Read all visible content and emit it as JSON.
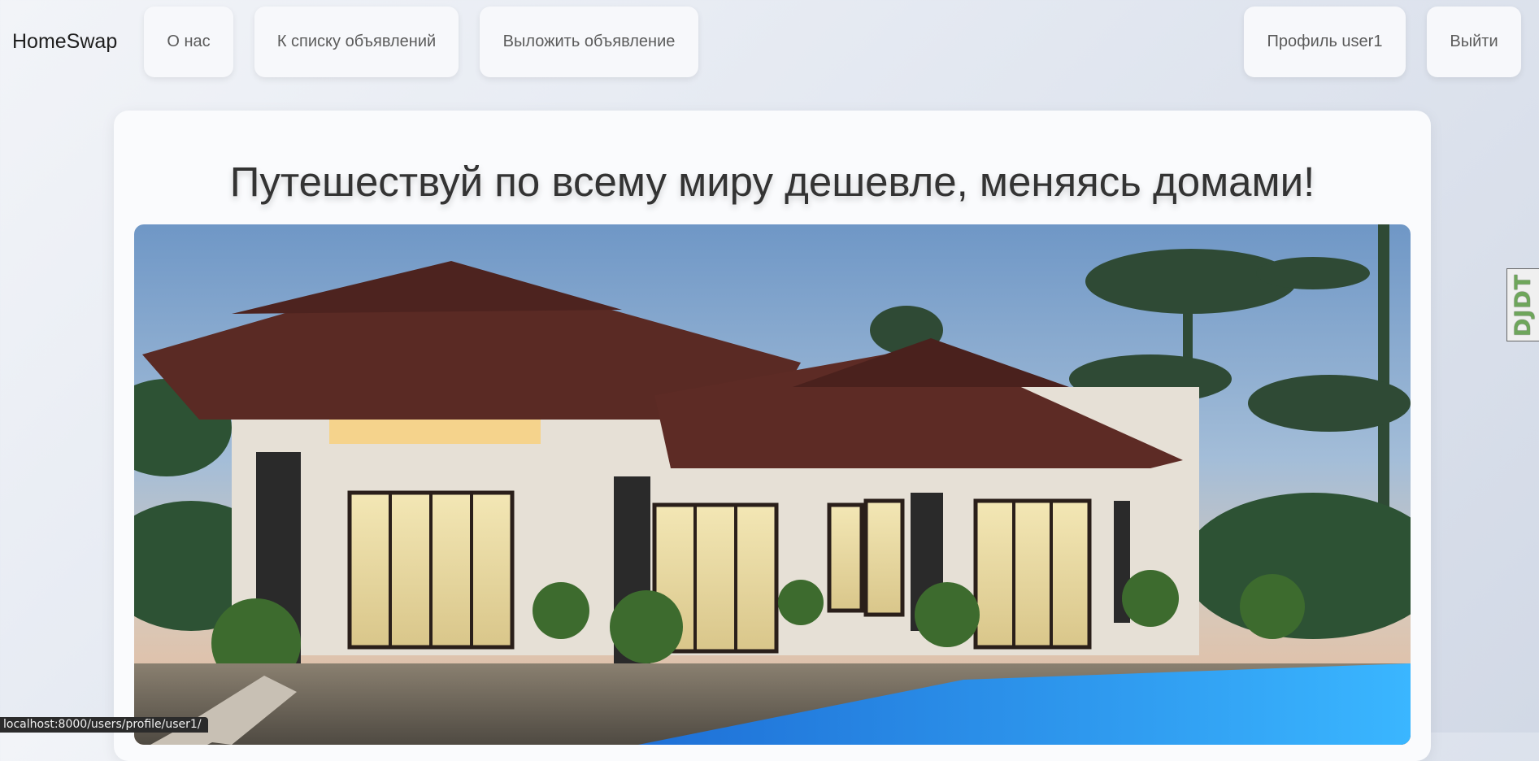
{
  "nav": {
    "brand": "HomeSwap",
    "about": "О нас",
    "listings": "К списку объявлений",
    "post": "Выложить объявление",
    "profile": "Профиль user1",
    "logout": "Выйти"
  },
  "hero": {
    "title": "Путешествуй по всему миру дешевле, меняясь домами!"
  },
  "debug_toolbar": {
    "label": "DJDT"
  },
  "status_bar": {
    "url": "localhost:8000/users/profile/user1/"
  }
}
